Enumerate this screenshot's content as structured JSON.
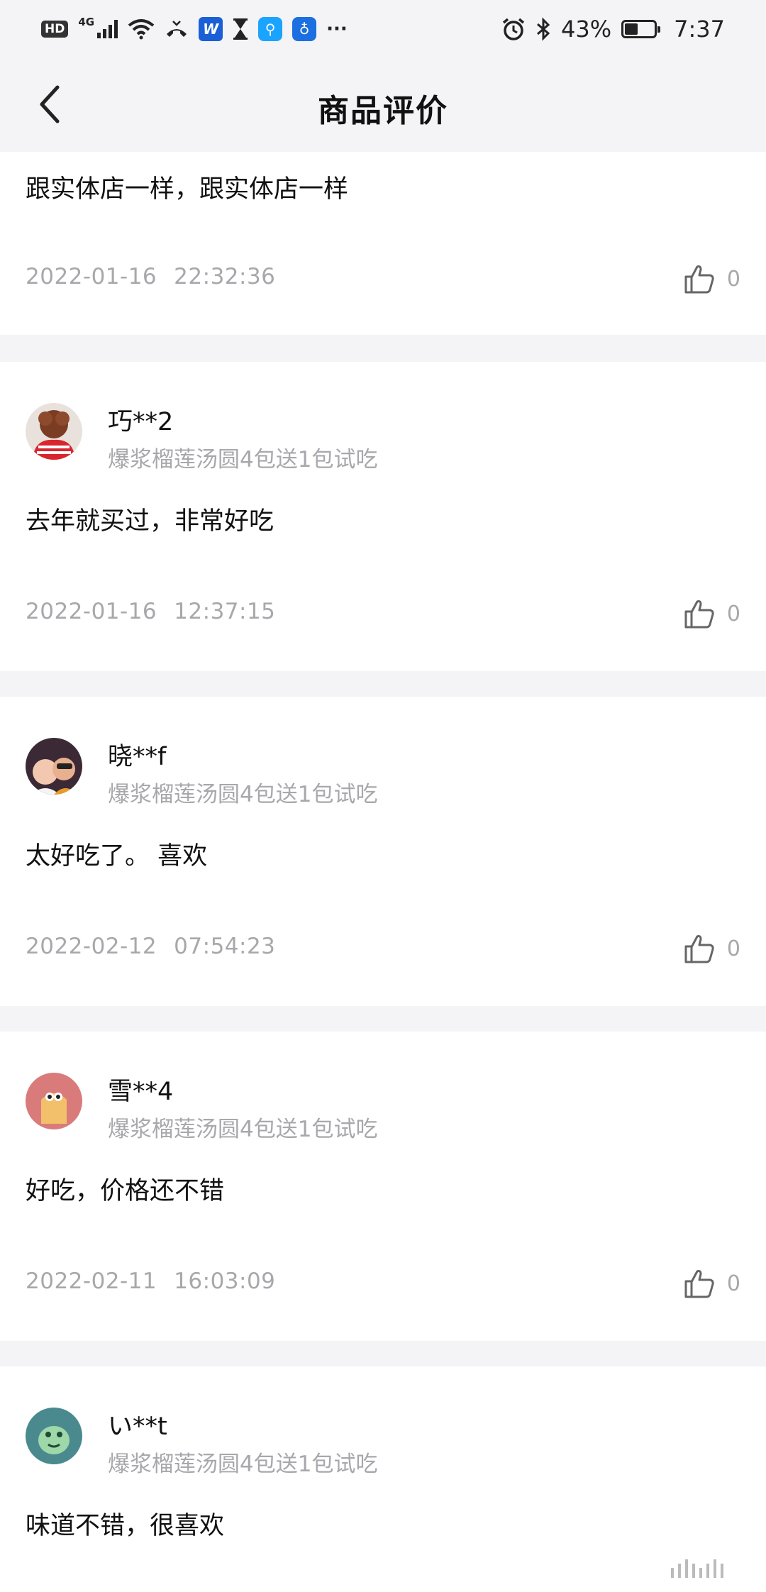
{
  "status_bar": {
    "hd": "HD",
    "network": "4G",
    "battery": "43%",
    "time": "7:37",
    "more": "···",
    "icons": [
      "hd-icon",
      "signal-icon",
      "wifi-icon",
      "missed-call-icon",
      "app-w-icon",
      "hourglass-icon",
      "search-app-icon",
      "bulb-app-icon",
      "alarm-icon",
      "bluetooth-icon",
      "battery-icon"
    ]
  },
  "header": {
    "title": "商品评价",
    "back_icon": "chevron-left-icon"
  },
  "reviews": [
    {
      "content": "跟实体店一样，跟实体店一样",
      "date": "2022-01-16",
      "time": "22:32:36",
      "likes": "0"
    },
    {
      "username": "巧**2",
      "product": "爆浆榴莲汤圆4包送1包试吃",
      "content": "去年就买过，非常好吃",
      "date": "2022-01-16",
      "time": "12:37:15",
      "likes": "0"
    },
    {
      "username": "晓**f",
      "product": "爆浆榴莲汤圆4包送1包试吃",
      "content": "太好吃了。 喜欢",
      "date": "2022-02-12",
      "time": "07:54:23",
      "likes": "0"
    },
    {
      "username": "雪**4",
      "product": "爆浆榴莲汤圆4包送1包试吃",
      "content": "好吃，价格还不错",
      "date": "2022-02-11",
      "time": "16:03:09",
      "likes": "0"
    },
    {
      "username": "い**t",
      "product": "爆浆榴莲汤圆4包送1包试吃",
      "content": "味道不错，很喜欢"
    }
  ],
  "colors": {
    "background": "#f4f4f6",
    "card": "#ffffff",
    "text_primary": "#111111",
    "text_secondary": "#a8a8ac"
  }
}
